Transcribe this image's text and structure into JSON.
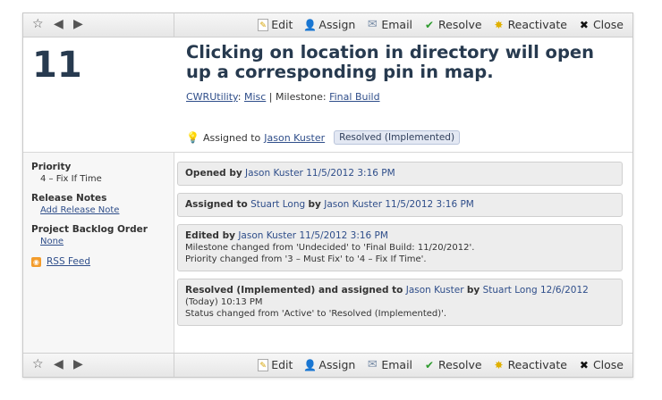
{
  "toolbar": {
    "edit": "Edit",
    "assign": "Assign",
    "email": "Email",
    "resolve": "Resolve",
    "reactivate": "Reactivate",
    "close": "Close"
  },
  "case": {
    "number": "11",
    "title": "Clicking on location in directory will open up a corresponding pin in map.",
    "project": "CWRUtility",
    "area": "Misc",
    "milestone_label": "Milestone:",
    "milestone": "Final Build",
    "assigned_label": "Assigned to",
    "assigned_to": "Jason Kuster",
    "status": "Resolved (Implemented)"
  },
  "fields": {
    "priority_label": "Priority",
    "priority_value": "4 – Fix If Time",
    "release_notes_label": "Release Notes",
    "release_notes_link": "Add Release Note",
    "backlog_label": "Project Backlog Order",
    "backlog_value": "None",
    "rss": "RSS Feed"
  },
  "events": [
    {
      "action": "Opened by",
      "user": "Jason Kuster",
      "date": "11/5/2012 3:16 PM"
    },
    {
      "action": "Assigned to",
      "target": "Stuart Long",
      "by": "by",
      "user": "Jason Kuster",
      "date": "11/5/2012 3:16 PM"
    },
    {
      "action": "Edited by",
      "user": "Jason Kuster",
      "date": "11/5/2012 3:16 PM",
      "line1": "Milestone changed from 'Undecided' to 'Final Build: 11/20/2012'.",
      "line2": "Priority changed from '3 – Must Fix' to '4 – Fix If Time'."
    },
    {
      "action": "Resolved (Implemented) and assigned to",
      "target": "Jason Kuster",
      "by": "by",
      "user": "Stuart Long",
      "date": "12/6/2012",
      "date2": "(Today) 10:13 PM",
      "line1": "Status changed from 'Active' to 'Resolved (Implemented)'."
    }
  ],
  "icons": {
    "star": "star-icon",
    "back": "arrow-left-icon",
    "forward": "arrow-right-icon",
    "edit": "edit-icon",
    "assign": "person-icon",
    "email": "envelope-icon",
    "resolve": "checkmark-icon",
    "reactivate": "sun-icon",
    "close": "x-icon",
    "bulb": "lightbulb-icon",
    "rss": "rss-icon"
  }
}
